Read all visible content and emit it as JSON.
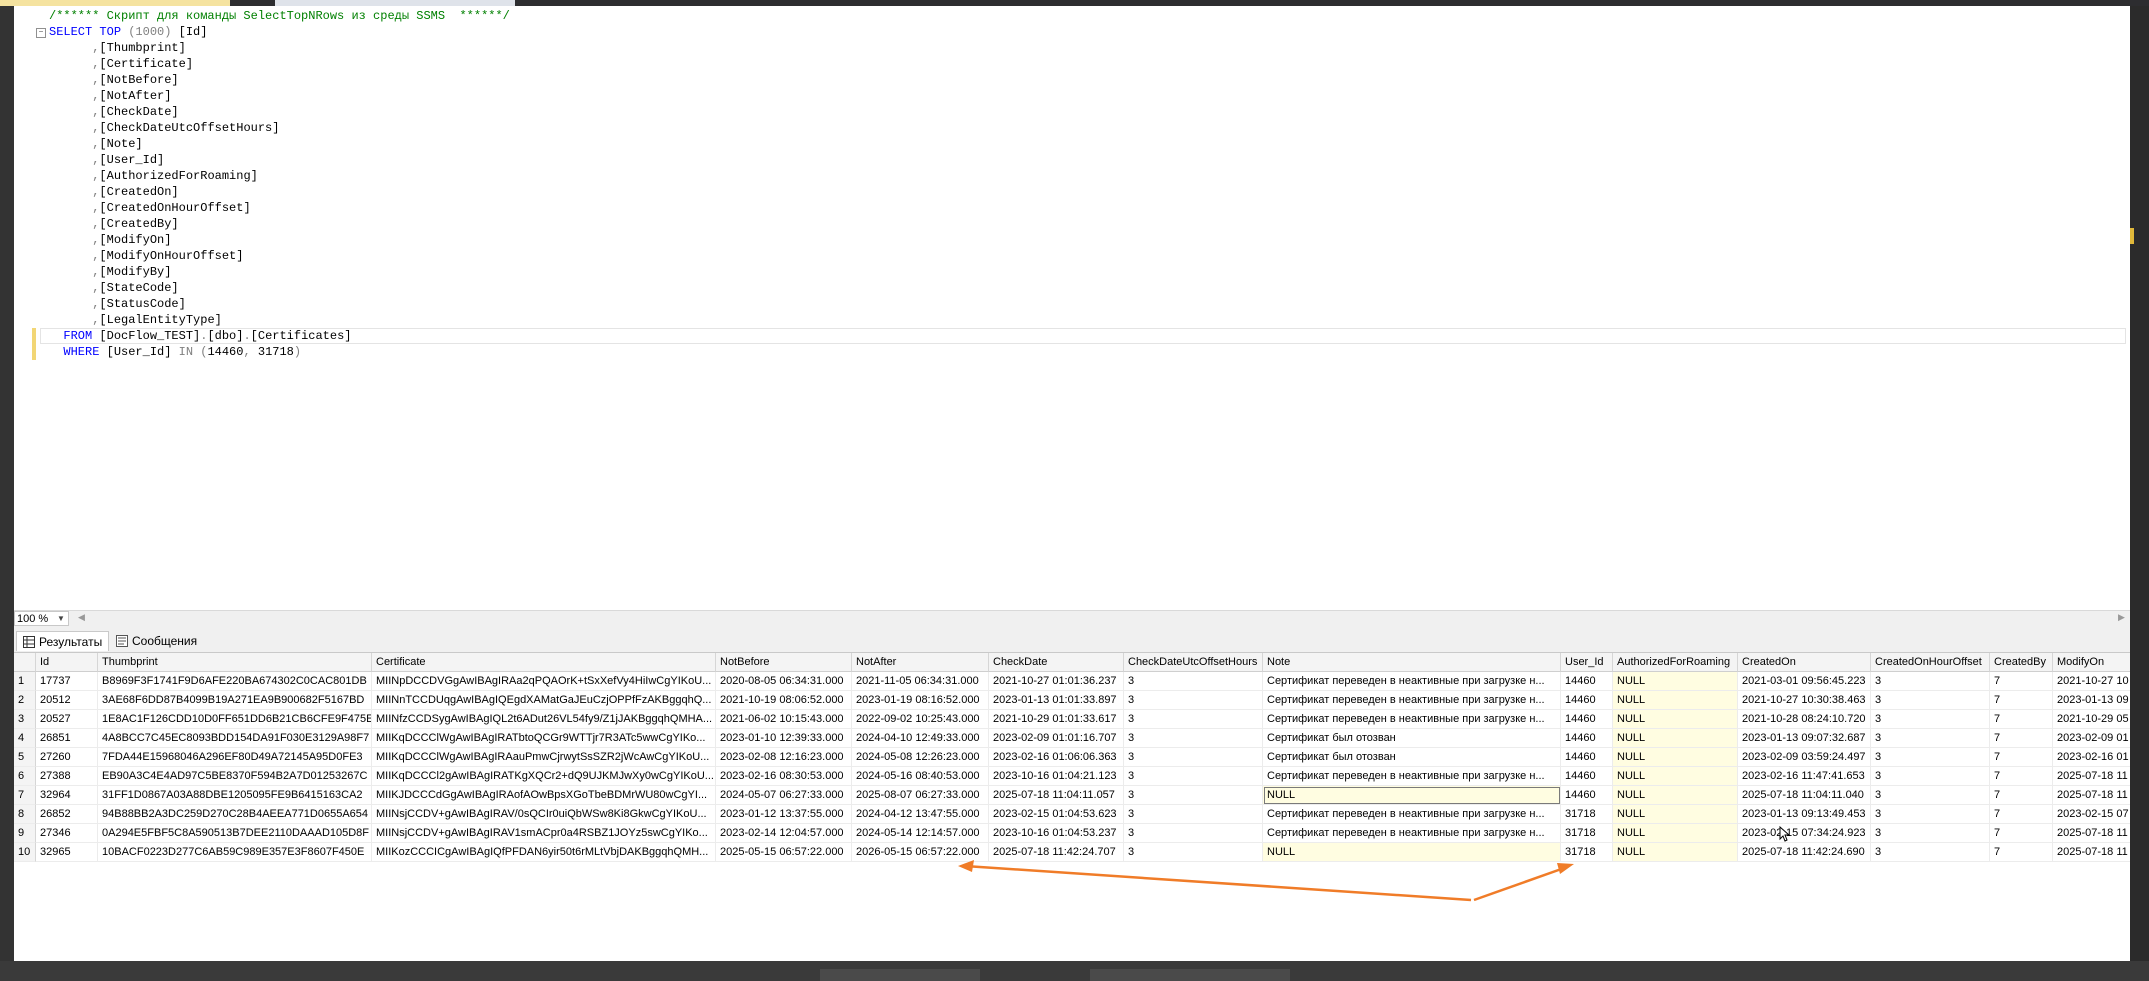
{
  "colors": {
    "keyword": "#0000ff",
    "comment": "#008000",
    "operator": "#808080",
    "annotation_arrow": "#f07c28",
    "null_cell": "#fffde1"
  },
  "editor": {
    "lines": [
      {
        "type": "comment",
        "indent": "",
        "text": "/****** Скрипт для команды SelectTopNRows из среды SSMS  ******/"
      },
      {
        "type": "select",
        "fold": "⊟",
        "k1": "SELECT",
        "k2": "TOP",
        "op": "(1000)",
        "rest": " [Id]"
      },
      {
        "type": "col",
        "indent": "      ",
        "comma": ",",
        "text": "[Thumbprint]"
      },
      {
        "type": "col",
        "indent": "      ",
        "comma": ",",
        "text": "[Certificate]"
      },
      {
        "type": "col",
        "indent": "      ",
        "comma": ",",
        "text": "[NotBefore]"
      },
      {
        "type": "col",
        "indent": "      ",
        "comma": ",",
        "text": "[NotAfter]"
      },
      {
        "type": "col",
        "indent": "      ",
        "comma": ",",
        "text": "[CheckDate]"
      },
      {
        "type": "col",
        "indent": "      ",
        "comma": ",",
        "text": "[CheckDateUtcOffsetHours]"
      },
      {
        "type": "col",
        "indent": "      ",
        "comma": ",",
        "text": "[Note]"
      },
      {
        "type": "col",
        "indent": "      ",
        "comma": ",",
        "text": "[User_Id]"
      },
      {
        "type": "col",
        "indent": "      ",
        "comma": ",",
        "text": "[AuthorizedForRoaming]"
      },
      {
        "type": "col",
        "indent": "      ",
        "comma": ",",
        "text": "[CreatedOn]"
      },
      {
        "type": "col",
        "indent": "      ",
        "comma": ",",
        "text": "[CreatedOnHourOffset]"
      },
      {
        "type": "col",
        "indent": "      ",
        "comma": ",",
        "text": "[CreatedBy]"
      },
      {
        "type": "col",
        "indent": "      ",
        "comma": ",",
        "text": "[ModifyOn]"
      },
      {
        "type": "col",
        "indent": "      ",
        "comma": ",",
        "text": "[ModifyOnHourOffset]"
      },
      {
        "type": "col",
        "indent": "      ",
        "comma": ",",
        "text": "[ModifyBy]"
      },
      {
        "type": "col",
        "indent": "      ",
        "comma": ",",
        "text": "[StateCode]"
      },
      {
        "type": "col",
        "indent": "      ",
        "comma": ",",
        "text": "[StatusCode]"
      },
      {
        "type": "col",
        "indent": "      ",
        "comma": ",",
        "text": "[LegalEntityType]"
      },
      {
        "type": "from",
        "indent": "  ",
        "k1": "FROM",
        "p1": "[DocFlow_TEST]",
        "d1": ".",
        "p2": "[dbo]",
        "d2": ".",
        "p3": "[Certificates]"
      },
      {
        "type": "where",
        "indent": "  ",
        "k1": "WHERE",
        "p1": "[User_Id]",
        "op1": "IN",
        "op2": "(",
        "n1": "14460",
        "c": ",",
        "n2": "31718",
        "op3": ")"
      }
    ]
  },
  "zoom": {
    "value": "100 %"
  },
  "tabs": [
    {
      "label": "Результаты",
      "icon": "grid-icon"
    },
    {
      "label": "Сообщения",
      "icon": "messages-icon"
    }
  ],
  "grid": {
    "columns": [
      "",
      "Id",
      "Thumbprint",
      "Certificate",
      "NotBefore",
      "NotAfter",
      "CheckDate",
      "CheckDateUtcOffsetHours",
      "Note",
      "User_Id",
      "AuthorizedForRoaming",
      "CreatedOn",
      "CreatedOnHourOffset",
      "CreatedBy",
      "ModifyOn"
    ],
    "rows": [
      [
        "1",
        "17737",
        "B8969F3F1741F9D6AFE220BA674302C0CAC801DB",
        "MIINpDCCDVGgAwIBAgIRAa2qPQAOrK+tSxXefVy4HiIwCgYIKoU...",
        "2020-08-05 06:34:31.000",
        "2021-11-05 06:34:31.000",
        "2021-10-27 01:01:36.237",
        "3",
        "Сертификат переведен в неактивные при загрузке н...",
        "14460",
        "NULL",
        "2021-03-01 09:56:45.223",
        "3",
        "7",
        "2021-10-27 10"
      ],
      [
        "2",
        "20512",
        "3AE68F6DD87B4099B19A271EA9B900682F5167BD",
        "MIINnTCCDUqgAwIBAgIQEgdXAMatGaJEuCzjOPPfFzAKBggqhQ...",
        "2021-10-19 08:06:52.000",
        "2023-01-19 08:16:52.000",
        "2023-01-13 01:01:33.897",
        "3",
        "Сертификат переведен в неактивные при загрузке н...",
        "14460",
        "NULL",
        "2021-10-27 10:30:38.463",
        "3",
        "7",
        "2023-01-13 09"
      ],
      [
        "3",
        "20527",
        "1E8AC1F126CDD10D0FF651DD6B21CB6CFE9F475E",
        "MIINfzCCDSygAwIBAgIQL2t6ADut26VL54fy9/Z1jJAKBggqhQMHA...",
        "2021-06-02 10:15:43.000",
        "2022-09-02 10:25:43.000",
        "2021-10-29 01:01:33.617",
        "3",
        "Сертификат переведен в неактивные при загрузке н...",
        "14460",
        "NULL",
        "2021-10-28 08:24:10.720",
        "3",
        "7",
        "2021-10-29 05"
      ],
      [
        "4",
        "26851",
        "4A8BCC7C45EC8093BDD154DA91F030E3129A98F7",
        "MIIKqDCCClWgAwIBAgIRATbtoQCGr9WTTjr7R3ATc5wwCgYIKo...",
        "2023-01-10 12:39:33.000",
        "2024-04-10 12:49:33.000",
        "2023-02-09 01:01:16.707",
        "3",
        "Сертификат был отозван",
        "14460",
        "NULL",
        "2023-01-13 09:07:32.687",
        "3",
        "7",
        "2023-02-09 01"
      ],
      [
        "5",
        "27260",
        "7FDA44E15968046A296EF80D49A72145A95D0FE3",
        "MIIKqDCCClWgAwIBAgIRAauPmwCjrwytSsSZR2jWcAwCgYIKoU...",
        "2023-02-08 12:16:23.000",
        "2024-05-08 12:26:23.000",
        "2023-02-16 01:06:06.363",
        "3",
        "Сертификат был отозван",
        "14460",
        "NULL",
        "2023-02-09 03:59:24.497",
        "3",
        "7",
        "2023-02-16 01"
      ],
      [
        "6",
        "27388",
        "EB90A3C4E4AD97C5BE8370F594B2A7D01253267C",
        "MIIKqDCCCl2gAwIBAgIRATKgXQCr2+dQ9UJKMJwXy0wCgYIKoU...",
        "2023-02-16 08:30:53.000",
        "2024-05-16 08:40:53.000",
        "2023-10-16 01:04:21.123",
        "3",
        "Сертификат переведен в неактивные при загрузке н...",
        "14460",
        "NULL",
        "2023-02-16 11:47:41.653",
        "3",
        "7",
        "2025-07-18 11"
      ],
      [
        "7",
        "32964",
        "31FF1D0867A03A88DBE1205095FE9B6415163CA2",
        "MIIKJDCCCdGgAwIBAgIRAofAOwBpsXGoTbeBDMrWU80wCgYI...",
        "2024-05-07 06:27:33.000",
        "2025-08-07 06:27:33.000",
        "2025-07-18 11:04:11.057",
        "3",
        "NULL",
        "14460",
        "NULL",
        "2025-07-18 11:04:11.040",
        "3",
        "7",
        "2025-07-18 11"
      ],
      [
        "8",
        "26852",
        "94B88BB2A3DC259D270C28B4AEEA771D0655A654",
        "MIINsjCCDV+gAwIBAgIRAV/0sQCIr0uiQbWSw8Ki8GkwCgYIKoU...",
        "2023-01-12 13:37:55.000",
        "2024-04-12 13:47:55.000",
        "2023-02-15 01:04:53.623",
        "3",
        "Сертификат переведен в неактивные при загрузке н...",
        "31718",
        "NULL",
        "2023-01-13 09:13:49.453",
        "3",
        "7",
        "2023-02-15 07"
      ],
      [
        "9",
        "27346",
        "0A294E5FBF5C8A590513B7DEE2110DAAAD105D8F",
        "MIINsjCCDV+gAwIBAgIRAV1smACpr0a4RSBZ1JOYz5swCgYIKo...",
        "2023-02-14 12:04:57.000",
        "2024-05-14 12:14:57.000",
        "2023-10-16 01:04:53.237",
        "3",
        "Сертификат переведен в неактивные при загрузке н...",
        "31718",
        "NULL",
        "2023-02-15 07:34:24.923",
        "3",
        "7",
        "2025-07-18 11"
      ],
      [
        "10",
        "32965",
        "10BACF0223D277C6AB59C989E357E3F8607F450E",
        "MIIKozCCCICgAwIBAgIQfPFDAN6yir50t6rMLtVbjDAKBggqhQMH...",
        "2025-05-15 06:57:22.000",
        "2026-05-15 06:57:22.000",
        "2025-07-18 11:42:24.707",
        "3",
        "NULL",
        "31718",
        "NULL",
        "2025-07-18 11:42:24.690",
        "3",
        "7",
        "2025-07-18 11"
      ]
    ]
  }
}
